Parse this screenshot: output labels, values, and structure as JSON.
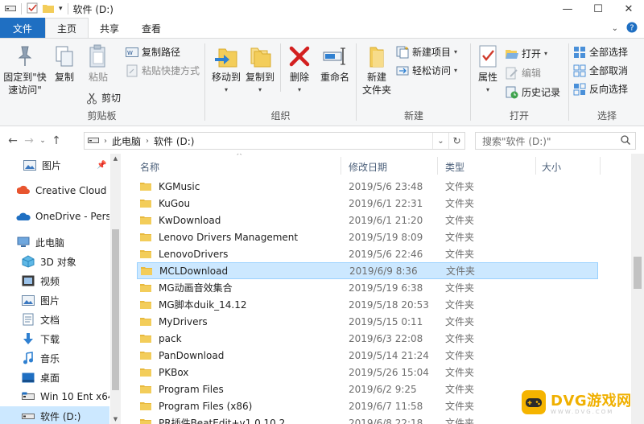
{
  "window": {
    "title": "软件 (D:)",
    "minimize": "—",
    "maximize": "☐",
    "close": "✕"
  },
  "tabs": [
    "文件",
    "主页",
    "共享",
    "查看"
  ],
  "ribbon": {
    "clipboard": {
      "label": "剪贴板",
      "pin": "固定到\"快速访问\"",
      "copy": "复制",
      "paste": "粘贴",
      "copy_path": "复制路径",
      "paste_shortcut": "粘贴快捷方式",
      "cut": "剪切"
    },
    "organize": {
      "label": "组织",
      "move_to": "移动到",
      "copy_to": "复制到",
      "delete": "删除",
      "rename": "重命名"
    },
    "new": {
      "label": "新建",
      "new_folder": "新建\n文件夹",
      "new_item": "新建项目",
      "easy_access": "轻松访问"
    },
    "open": {
      "label": "打开",
      "properties": "属性",
      "open": "打开",
      "edit": "编辑",
      "history": "历史记录"
    },
    "select": {
      "label": "选择",
      "select_all": "全部选择",
      "select_none": "全部取消",
      "invert": "反向选择"
    }
  },
  "address": {
    "crumbs": [
      "此电脑",
      "软件 (D:)"
    ],
    "search_placeholder": "搜索\"软件 (D:)\""
  },
  "nav_pane": [
    {
      "label": "图片",
      "icon": "pictures-icon",
      "pinned": true
    },
    {
      "label": "Creative Cloud F",
      "icon": "creative-cloud-icon"
    },
    {
      "label": "OneDrive - Perso",
      "icon": "onedrive-icon"
    },
    {
      "label": "此电脑",
      "icon": "this-pc-icon"
    },
    {
      "label": "3D 对象",
      "icon": "3d-objects-icon"
    },
    {
      "label": "视频",
      "icon": "videos-icon"
    },
    {
      "label": "图片",
      "icon": "pictures-icon"
    },
    {
      "label": "文档",
      "icon": "documents-icon"
    },
    {
      "label": "下载",
      "icon": "downloads-icon"
    },
    {
      "label": "音乐",
      "icon": "music-icon"
    },
    {
      "label": "桌面",
      "icon": "desktop-icon"
    },
    {
      "label": "Win 10 Ent x64",
      "icon": "drive-icon"
    },
    {
      "label": "软件 (D:)",
      "icon": "drive-icon",
      "selected": true
    }
  ],
  "columns": {
    "name": "名称",
    "modified": "修改日期",
    "type": "类型",
    "size": "大小"
  },
  "files": [
    {
      "name": "KGMusic",
      "date": "2019/5/6 23:48",
      "type": "文件夹"
    },
    {
      "name": "KuGou",
      "date": "2019/6/1 22:31",
      "type": "文件夹"
    },
    {
      "name": "KwDownload",
      "date": "2019/6/1 21:20",
      "type": "文件夹"
    },
    {
      "name": "Lenovo Drivers Management",
      "date": "2019/5/19 8:09",
      "type": "文件夹"
    },
    {
      "name": "LenovoDrivers",
      "date": "2019/5/6 22:46",
      "type": "文件夹"
    },
    {
      "name": "MCLDownload",
      "date": "2019/6/9 8:36",
      "type": "文件夹",
      "selected": true
    },
    {
      "name": "MG动画音效集合",
      "date": "2019/5/19 6:38",
      "type": "文件夹"
    },
    {
      "name": "MG脚本duik_14.12",
      "date": "2019/5/18 20:53",
      "type": "文件夹"
    },
    {
      "name": "MyDrivers",
      "date": "2019/5/15 0:11",
      "type": "文件夹"
    },
    {
      "name": "pack",
      "date": "2019/6/3 22:08",
      "type": "文件夹"
    },
    {
      "name": "PanDownload",
      "date": "2019/5/14 21:24",
      "type": "文件夹"
    },
    {
      "name": "PKBox",
      "date": "2019/5/26 15:04",
      "type": "文件夹"
    },
    {
      "name": "Program Files",
      "date": "2019/6/2 9:25",
      "type": "文件夹"
    },
    {
      "name": "Program Files (x86)",
      "date": "2019/6/7 11:58",
      "type": "文件夹"
    },
    {
      "name": "PR插件BeatEdit+v1.0.10.2",
      "date": "2019/6/8 22:18",
      "type": "文件夹"
    }
  ],
  "watermark": {
    "brand": "DVG游戏网",
    "url": "WWW.DVG.COM"
  },
  "colors": {
    "file_tab": "#1f6fc2",
    "selection": "#cce8ff",
    "folder": "#e8b93e"
  }
}
